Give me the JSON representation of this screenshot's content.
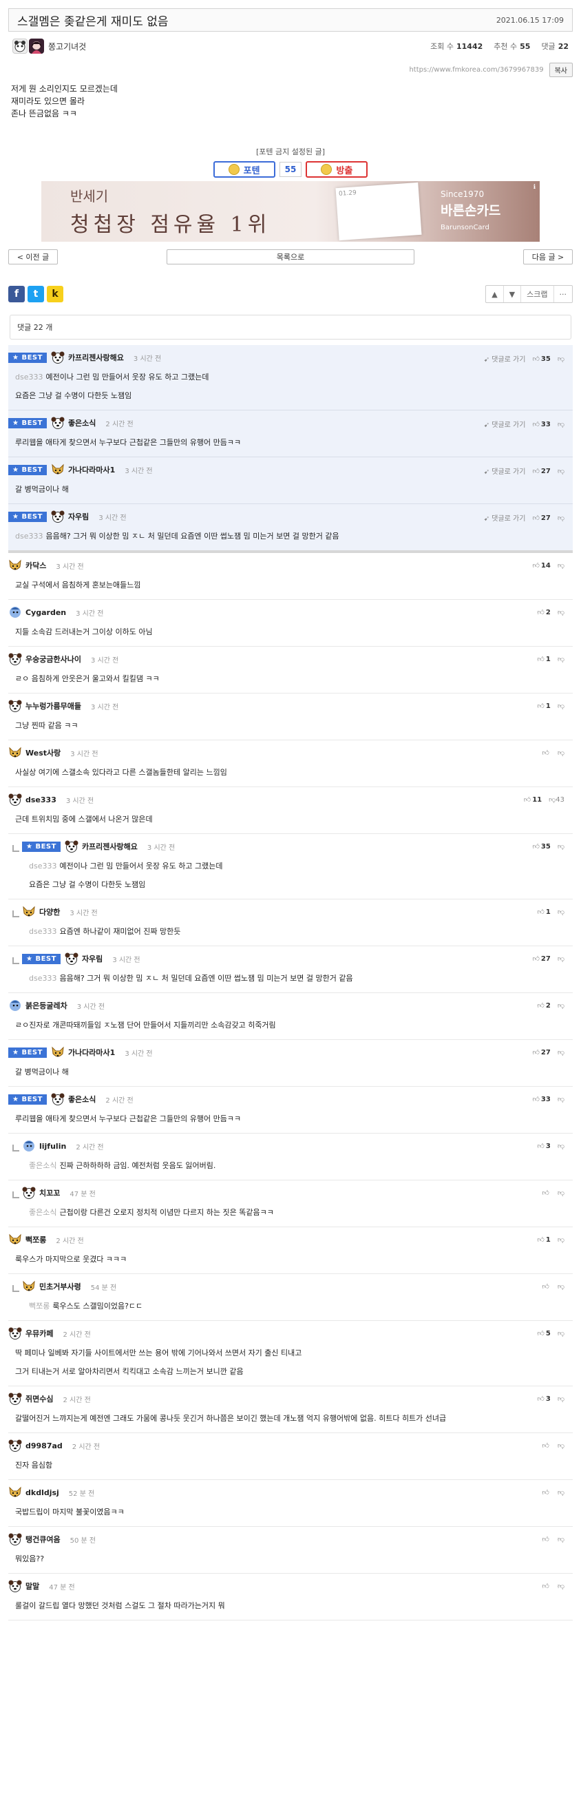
{
  "post": {
    "title": "스갤멤은 좆같은게 재미도 없음",
    "date": "2021.06.15 17:09",
    "author": "쫑고기녀것",
    "views_label": "조회 수",
    "views": "11442",
    "rec_label": "추천 수",
    "rec": "55",
    "cmt_label": "댓글",
    "cmt": "22",
    "url": "https://www.fmkorea.com/3679967839",
    "copy_label": "복사",
    "body": [
      "저게 뭔 소리인지도 모르겠는데",
      "재미라도 있으면 몰라",
      "존나 뜬금없음 ㅋㅋ"
    ]
  },
  "vote": {
    "notice": "[포텐 금지 설정된 글]",
    "up_label": "포텐",
    "count": "55",
    "down_label": "방출"
  },
  "ad": {
    "l1": "반세기",
    "l2": "청첩장 점유율 1위",
    "r1": "Since1970",
    "r2": "바른손카드",
    "r3": "BarunsonCard",
    "card": "01.29"
  },
  "nav": {
    "prev": "< 이전 글",
    "list": "목록으로",
    "next": "다음 글 >"
  },
  "share": {
    "fb": "f",
    "tw": "t",
    "ks": "k",
    "scrap": "스크랩",
    "up": "▲",
    "down": "▼",
    "more": "···"
  },
  "comment_count": "댓글 22 개",
  "colors": {
    "best_bg": "#eef2fa",
    "badge": "#3b73d6",
    "up_vote": "#2f5fcf",
    "down_vote": "#d33"
  },
  "comments": [
    {
      "type": "best",
      "best": "★ BEST",
      "name": "카프리젠사랑해요",
      "time": "3 시간 전",
      "reply": "댓글로 가기",
      "up": "35",
      "down": "",
      "quote": "dse333",
      "lines": [
        "예전이나 그런 밈 만들어서 웃장 유도 하고 그랬는데",
        "요즘은 그냥 걸 수명이 다한듯 노잼임"
      ],
      "av": "dog"
    },
    {
      "type": "best",
      "best": "★ BEST",
      "name": "좋은소식",
      "time": "2 시간 전",
      "reply": "댓글로 가기",
      "up": "33",
      "down": "",
      "quote": "",
      "lines": [
        "루리웹을 애타게 찾으면서 누구보다 근첩같은 그들만의 유행어 만듬ㅋㅋ"
      ],
      "av": "dog"
    },
    {
      "type": "best",
      "best": "★ BEST",
      "name": "가나다라마사1",
      "time": "3 시간 전",
      "reply": "댓글로 가기",
      "up": "27",
      "down": "",
      "quote": "",
      "lines": [
        "갈 병먹금이나 해"
      ],
      "av": "fox"
    },
    {
      "type": "best last",
      "best": "★ BEST",
      "name": "자우림",
      "time": "3 시간 전",
      "reply": "댓글로 가기",
      "up": "27",
      "down": "",
      "quote": "dse333",
      "lines": [
        "음음해? 그거 뭐 이상한 밈 ㅈㄴ 처 밀던데 요즘엔 이딴 썹노잼 밈 미는거 보면 걸 망한거 같음"
      ],
      "av": "dog"
    },
    {
      "type": "normal",
      "best": "",
      "name": "카닥스",
      "time": "3 시간 전",
      "reply": "",
      "up": "14",
      "down": "",
      "quote": "",
      "lines": [
        "교실 구석에서 음침하게 혼보는애들느낌"
      ],
      "av": "fox"
    },
    {
      "type": "normal",
      "best": "",
      "name": "Cygarden",
      "time": "3 시간 전",
      "reply": "",
      "up": "2",
      "down": "",
      "quote": "",
      "lines": [
        "지들 소속감 드러내는거 그이상 이하도 아님"
      ],
      "av": "blue"
    },
    {
      "type": "normal",
      "best": "",
      "name": "우숭궁금한사나이",
      "time": "3 시간 전",
      "reply": "",
      "up": "1",
      "down": "",
      "quote": "",
      "lines": [
        "ㄹㅇ 음침하게 안웃은거 울고와서 킬킬댐 ㅋㅋ"
      ],
      "av": "dog"
    },
    {
      "type": "normal",
      "best": "",
      "name": "누누렁가름무애들",
      "time": "3 시간 전",
      "reply": "",
      "up": "1",
      "down": "",
      "quote": "",
      "lines": [
        "그냥 찐따 같음 ㅋㅋ"
      ],
      "av": "dog"
    },
    {
      "type": "normal",
      "best": "",
      "name": "West사랑",
      "time": "3 시간 전",
      "reply": "",
      "up": "",
      "down": "",
      "quote": "",
      "lines": [
        "사실상 여기에 스갤소속 있다라고 다른 스갤놈들한테 알리는 느낌임"
      ],
      "av": "fox"
    },
    {
      "type": "normal",
      "best": "",
      "name": "dse333",
      "time": "3 시간 전",
      "reply": "",
      "up": "11",
      "down": "43",
      "quote": "",
      "lines": [
        "근데 트위치밈 중에 스갤에서 나온거 많은데"
      ],
      "av": "dog"
    },
    {
      "type": "reply",
      "best": "★ BEST",
      "name": "카프리젠사랑해요",
      "time": "3 시간 전",
      "reply": "",
      "up": "35",
      "down": "",
      "quote": "dse333",
      "lines": [
        "예전이나 그런 밈 만들어서 웃장 유도 하고 그랬는데",
        "요즘은 그냥 걸 수명이 다한듯 노잼임"
      ],
      "av": "dog"
    },
    {
      "type": "reply",
      "best": "",
      "name": "다양한",
      "time": "3 시간 전",
      "reply": "",
      "up": "1",
      "down": "",
      "quote": "dse333",
      "lines": [
        "요즘엔 하나같이 재미없어 진짜 망한듯"
      ],
      "av": "fox"
    },
    {
      "type": "reply",
      "best": "★ BEST",
      "name": "자우림",
      "time": "3 시간 전",
      "reply": "",
      "up": "27",
      "down": "",
      "quote": "dse333",
      "lines": [
        "음음해? 그거 뭐 이상한 밈 ㅈㄴ 처 밀던데 요즘엔 이딴 썹노잼 밈 미는거 보면 걸 망한거 같음"
      ],
      "av": "dog"
    },
    {
      "type": "normal",
      "best": "",
      "name": "붉은등굴레차",
      "time": "3 시간 전",
      "reply": "",
      "up": "2",
      "down": "",
      "quote": "",
      "lines": [
        "ㄹㅇ진자로 개콘따돼끼들임 ㅈ노잼 단어 만들어서 지들끼리만 소속감갖고 히죽거림"
      ],
      "av": "blue"
    },
    {
      "type": "normal",
      "best": "★ BEST",
      "name": "가나다라마사1",
      "time": "3 시간 전",
      "reply": "",
      "up": "27",
      "down": "",
      "quote": "",
      "lines": [
        "갈 병먹금이나 해"
      ],
      "av": "fox"
    },
    {
      "type": "normal",
      "best": "★ BEST",
      "name": "좋은소식",
      "time": "2 시간 전",
      "reply": "",
      "up": "33",
      "down": "",
      "quote": "",
      "lines": [
        "루리웹을 애타게 찾으면서 누구보다 근첩같은 그들만의 유행어 만듬ㅋㅋ"
      ],
      "av": "dog"
    },
    {
      "type": "reply",
      "best": "",
      "name": "lijfulin",
      "time": "2 시간 전",
      "reply": "",
      "up": "3",
      "down": "",
      "quote": "좋은소식",
      "lines": [
        "진짜 근하하하하 금임. 예전처럼 웃음도 잃어버림."
      ],
      "av": "blue"
    },
    {
      "type": "reply",
      "best": "",
      "name": "치꼬꼬",
      "time": "47 분 전",
      "reply": "",
      "up": "",
      "down": "",
      "quote": "좋은소식",
      "lines": [
        "근첩이랑 다른건 오로지 정치적 이념만 다르지 하는 짓은 똑같음ㅋㅋ"
      ],
      "av": "dog"
    },
    {
      "type": "normal",
      "best": "",
      "name": "뻑쪼롱",
      "time": "2 시간 전",
      "reply": "",
      "up": "1",
      "down": "",
      "quote": "",
      "lines": [
        "룩우스가 마지막으로 웃겼다 ㅋㅋㅋ"
      ],
      "av": "fox"
    },
    {
      "type": "reply",
      "best": "",
      "name": "민초거부사령",
      "time": "54 분 전",
      "reply": "",
      "up": "",
      "down": "",
      "quote": "뻑쪼롱",
      "lines": [
        "룩우스도 스갤밈이었음?ㄷㄷ"
      ],
      "av": "fox"
    },
    {
      "type": "normal",
      "best": "",
      "name": "우뮤카페",
      "time": "2 시간 전",
      "reply": "",
      "up": "5",
      "down": "",
      "quote": "",
      "lines": [
        "딱 페미나 일베봐 자기들 사이트에서만 쓰는 용어 밖에 기어나와서 쓰면서 자기 출신 티내고",
        "그거 티내는거 서로 알아차리면서 킥킥대고 소속감 느끼는거 보니깐 같음"
      ],
      "av": "dog"
    },
    {
      "type": "normal",
      "best": "",
      "name": "쥐면수심",
      "time": "2 시간 전",
      "reply": "",
      "up": "3",
      "down": "",
      "quote": "",
      "lines": [
        "갈떨어진거 느꺄지는게 예전엔 그래도 가뭄에 콩나듯 웃긴거 하나쯤은 보이긴 했는데 개노잼 억지 유행어밖에 없음. 히트다 히트가 선녀급"
      ],
      "av": "dog"
    },
    {
      "type": "normal",
      "best": "",
      "name": "d9987ad",
      "time": "2 시간 전",
      "reply": "",
      "up": "",
      "down": "",
      "quote": "",
      "lines": [
        "진자 음심함"
      ],
      "av": "dog"
    },
    {
      "type": "normal",
      "best": "",
      "name": "dkdldjsj",
      "time": "52 분 전",
      "reply": "",
      "up": "",
      "down": "",
      "quote": "",
      "lines": [
        "국밥드립이 마지막 불꽃이였음ㅋㅋ"
      ],
      "av": "fox"
    },
    {
      "type": "normal",
      "best": "",
      "name": "탱건큐여음",
      "time": "50 분 전",
      "reply": "",
      "up": "",
      "down": "",
      "quote": "",
      "lines": [
        "뭐있음??"
      ],
      "av": "dog"
    },
    {
      "type": "normal",
      "best": "",
      "name": "말말",
      "time": "47 분 전",
      "reply": "",
      "up": "",
      "down": "",
      "quote": "",
      "lines": [
        "룰걸이 갈드립 열다 망했던 것처럼 스걸도 그 절차 따라가는거지 뭐"
      ],
      "av": "dog"
    }
  ]
}
